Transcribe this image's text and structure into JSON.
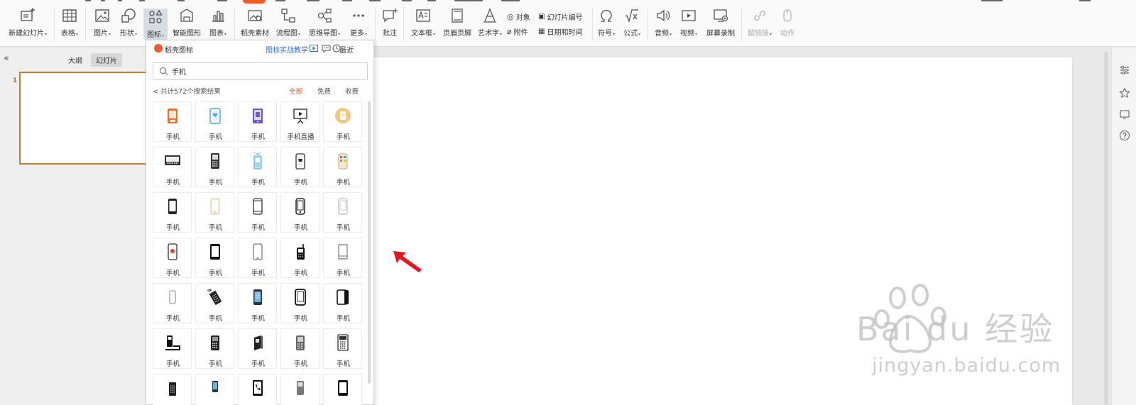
{
  "ribbon": {
    "new_slide": "新建幻灯片",
    "table": "表格",
    "picture": "图片",
    "shape": "形状",
    "icon": "图标",
    "smart_graphic": "智能图形",
    "chart": "图表",
    "material": "稻壳素材",
    "flowchart": "流程图",
    "mindmap": "思维导图",
    "more": "更多",
    "comment": "批注",
    "textbox": "文本框",
    "header_footer": "页眉页脚",
    "wordart": "艺术字",
    "object": "对象",
    "attachment": "附件",
    "slide_number": "幻灯片编号",
    "date_time": "日期和时间",
    "symbol": "符号",
    "formula": "公式",
    "audio": "音频",
    "video": "视频",
    "screen_record": "屏幕录制",
    "hyperlink": "超链接",
    "action": "动作",
    "dropdown_mark": "▾"
  },
  "left_panel": {
    "collapse": "«",
    "tab_outline": "大纲",
    "tab_slides": "幻灯片",
    "slide_number": "1"
  },
  "icon_panel": {
    "title": "稻壳图标",
    "tutorial": "图标实战教学",
    "recent": "最近",
    "search_value": "手机",
    "results_count": "共计572个搜索结果",
    "back": "<",
    "filters": [
      "全部",
      "免费",
      "收费"
    ],
    "active_filter": "全部",
    "icons": [
      {
        "label": "手机",
        "icon": "phone-orange-icon"
      },
      {
        "label": "手机",
        "icon": "phone-blue-heart-icon"
      },
      {
        "label": "手机",
        "icon": "phone-purple-icon"
      },
      {
        "label": "手机直播",
        "icon": "phone-live-stream-icon"
      },
      {
        "label": "手机",
        "icon": "phone-circle-gold-icon"
      },
      {
        "label": "手机",
        "icon": "phone-landscape-keyboard-icon"
      },
      {
        "label": "手机",
        "icon": "phone-keypad-icon"
      },
      {
        "label": "手机",
        "icon": "phone-signal-icon"
      },
      {
        "label": "手机",
        "icon": "phone-cart-icon"
      },
      {
        "label": "手机",
        "icon": "phone-colorful-apps-icon"
      },
      {
        "label": "手机",
        "icon": "smartphone-black-icon"
      },
      {
        "label": "手机",
        "icon": "phone-light-icon"
      },
      {
        "label": "手机",
        "icon": "phone-outline-icon"
      },
      {
        "label": "手机",
        "icon": "phone-outline-home-icon"
      },
      {
        "label": "手机",
        "icon": "phone-faint-outline-icon"
      },
      {
        "label": "手机",
        "icon": "phone-record-icon"
      },
      {
        "label": "手机",
        "icon": "phone-bold-icon"
      },
      {
        "label": "手机",
        "icon": "phone-thin-outline-icon"
      },
      {
        "label": "手机",
        "icon": "feature-phone-antenna-icon"
      },
      {
        "label": "手机",
        "icon": "phone-grey-outline-icon"
      },
      {
        "label": "手机",
        "icon": "phone-small-outline-icon"
      },
      {
        "label": "手机",
        "icon": "phone-ringing-tilted-icon"
      },
      {
        "label": "手机",
        "icon": "phone-screen-blue-icon"
      },
      {
        "label": "手机",
        "icon": "phone-rounded-outline-icon"
      },
      {
        "label": "手机",
        "icon": "phone-dual-icon"
      },
      {
        "label": "手机",
        "icon": "cordless-phone-icon"
      },
      {
        "label": "手机",
        "icon": "keypad-phone-dark-icon"
      },
      {
        "label": "手机",
        "icon": "phone-3d-icon"
      },
      {
        "label": "手机",
        "icon": "phone-grey-keypad-icon"
      },
      {
        "label": "手机",
        "icon": "phone-keypad-grid-icon"
      },
      {
        "label": "",
        "icon": "phone-flip-icon"
      },
      {
        "label": "",
        "icon": "phone-blue-small-icon"
      },
      {
        "label": "",
        "icon": "phone-call-icon"
      },
      {
        "label": "",
        "icon": "phone-grey-body-icon"
      },
      {
        "label": "",
        "icon": "phone-black-screen-icon"
      }
    ]
  },
  "watermark": {
    "brand": "Bai  du 经验",
    "url": "jingyan.baidu.com"
  },
  "colors": {
    "accent": "#ef5a2f",
    "link": "#2f6fd6",
    "arrow": "#e8151b"
  }
}
